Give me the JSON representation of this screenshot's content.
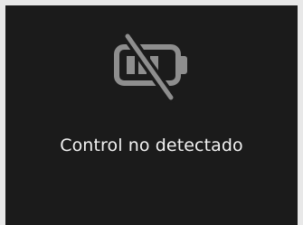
{
  "status": {
    "icon": "battery-disconnected-icon",
    "message": "Control no detectado"
  },
  "colors": {
    "frame": "#e8e8e8",
    "screen": "#1b1b1b",
    "icon": "#8e8e8e",
    "text": "#f2f2f2"
  }
}
